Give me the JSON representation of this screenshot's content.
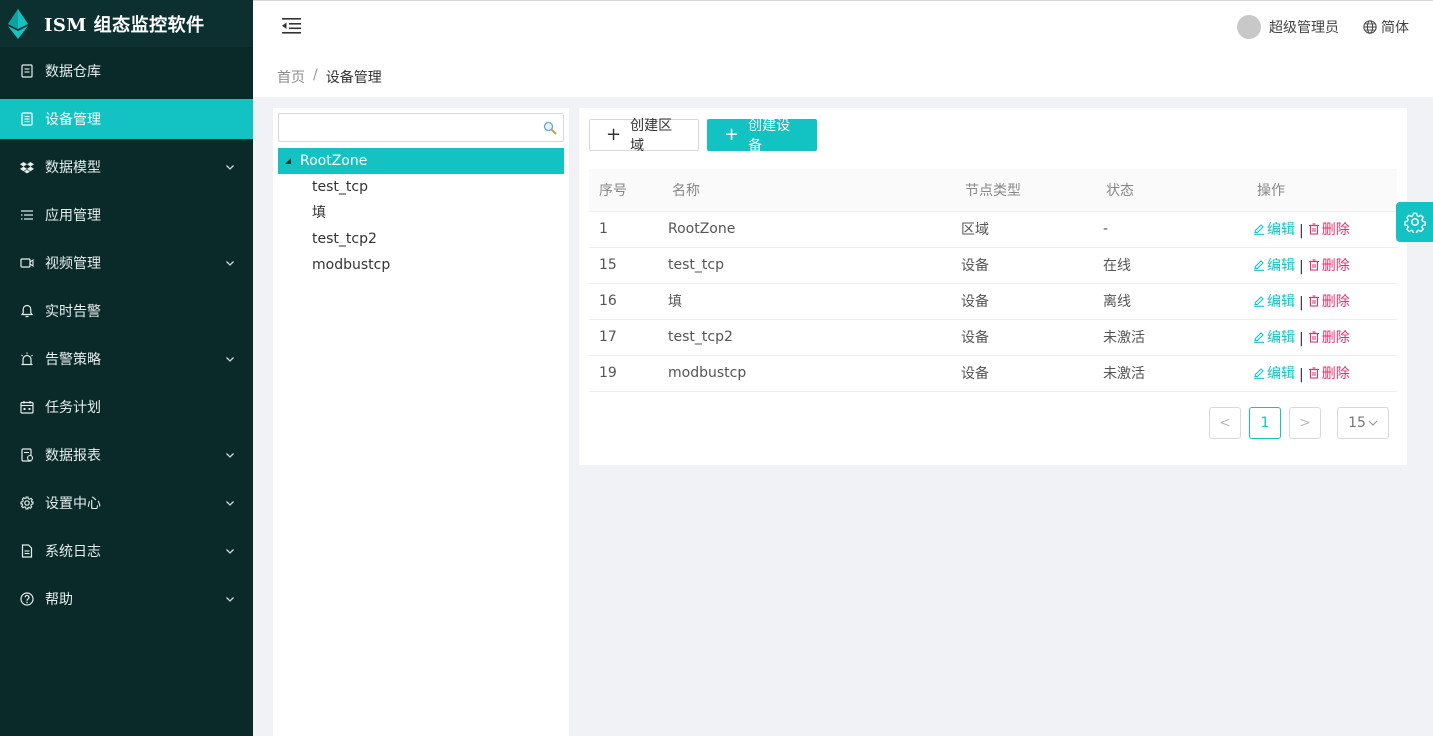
{
  "app": {
    "title": "ISM 组态监控软件"
  },
  "sidebar": {
    "items": [
      {
        "label": "数据仓库",
        "icon": "database-icon",
        "expandable": false,
        "active": false
      },
      {
        "label": "设备管理",
        "icon": "device-list-icon",
        "expandable": false,
        "active": true
      },
      {
        "label": "数据模型",
        "icon": "dropbox-icon",
        "expandable": true,
        "active": false
      },
      {
        "label": "应用管理",
        "icon": "list-icon",
        "expandable": false,
        "active": false
      },
      {
        "label": "视频管理",
        "icon": "video-icon",
        "expandable": true,
        "active": false
      },
      {
        "label": "实时告警",
        "icon": "bell-icon",
        "expandable": false,
        "active": false
      },
      {
        "label": "告警策略",
        "icon": "alarm-icon",
        "expandable": true,
        "active": false
      },
      {
        "label": "任务计划",
        "icon": "calendar-icon",
        "expandable": false,
        "active": false
      },
      {
        "label": "数据报表",
        "icon": "report-icon",
        "expandable": true,
        "active": false
      },
      {
        "label": "设置中心",
        "icon": "gear-icon",
        "expandable": true,
        "active": false
      },
      {
        "label": "系统日志",
        "icon": "file-icon",
        "expandable": true,
        "active": false
      },
      {
        "label": "帮助",
        "icon": "question-icon",
        "expandable": true,
        "active": false
      }
    ]
  },
  "header": {
    "user_name": "超级管理员",
    "language": "简体"
  },
  "breadcrumb": {
    "home": "首页",
    "separator": "/",
    "current": "设备管理"
  },
  "tree": {
    "search_placeholder": "",
    "root": "RootZone",
    "children": [
      "test_tcp",
      "填",
      "test_tcp2",
      "modbustcp"
    ]
  },
  "toolbar": {
    "create_area": "创建区域",
    "create_device": "创建设备"
  },
  "table": {
    "headers": {
      "no": "序号",
      "name": "名称",
      "type": "节点类型",
      "status": "状态",
      "ops": "操作"
    },
    "ops": {
      "edit": "编辑",
      "delete": "删除",
      "sep": "|"
    },
    "rows": [
      {
        "no": "1",
        "name": "RootZone",
        "type": "区域",
        "type_kind": "region",
        "status": "-",
        "status_kind": "none"
      },
      {
        "no": "15",
        "name": "test_tcp",
        "type": "设备",
        "type_kind": "device",
        "status": "在线",
        "status_kind": "online"
      },
      {
        "no": "16",
        "name": "填",
        "type": "设备",
        "type_kind": "device",
        "status": "离线",
        "status_kind": "offline"
      },
      {
        "no": "17",
        "name": "test_tcp2",
        "type": "设备",
        "type_kind": "device",
        "status": "未激活",
        "status_kind": "inactive"
      },
      {
        "no": "19",
        "name": "modbustcp",
        "type": "设备",
        "type_kind": "device",
        "status": "未激活",
        "status_kind": "inactive"
      }
    ]
  },
  "pagination": {
    "prev": "<",
    "current": "1",
    "next": ">",
    "page_size": "15"
  },
  "colors": {
    "accent": "#13c2c2",
    "sidebar_bg": "#0a2a2a",
    "region": "#f5c242",
    "device": "#5a0000",
    "online": "#1a6b1a",
    "inactive": "#c8000a",
    "delete": "#e0316e"
  }
}
